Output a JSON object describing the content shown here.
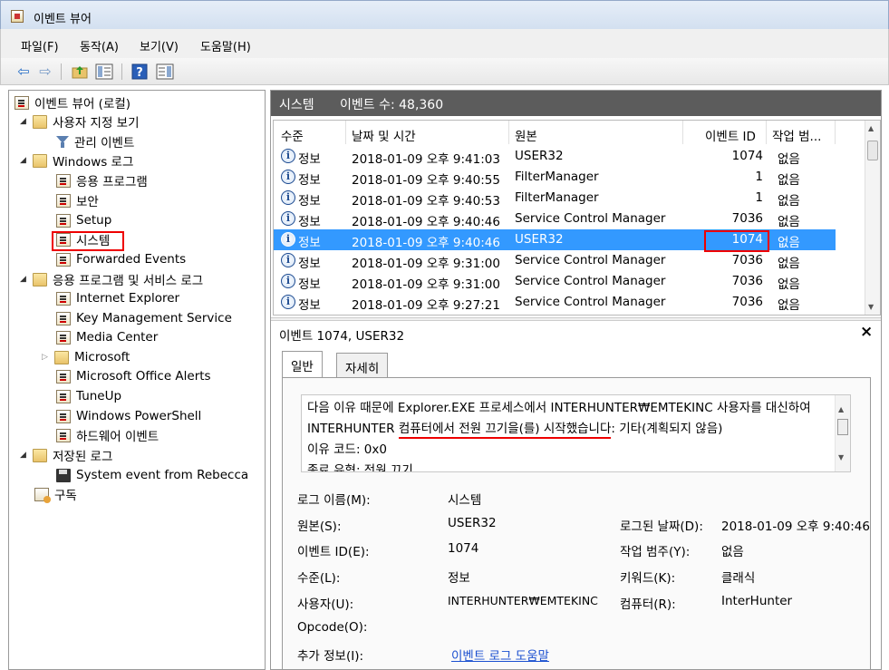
{
  "window": {
    "title": "이벤트 뷰어"
  },
  "menu": [
    "파일(F)",
    "동작(A)",
    "보기(V)",
    "도움말(H)"
  ],
  "toolbar": {
    "back_icon": "back-arrow-icon",
    "forward_icon": "forward-arrow-icon",
    "up_icon": "folder-up-icon",
    "show_tree_icon": "show-hide-tree-icon",
    "help_icon": "help-icon",
    "action_pane_icon": "action-pane-icon"
  },
  "tree": {
    "root": "이벤트 뷰어 (로컬)",
    "custom_views": "사용자 지정 보기",
    "admin_events": "관리 이벤트",
    "windows_logs": "Windows 로그",
    "application": "응용 프로그램",
    "security": "보안",
    "setup": "Setup",
    "system": "시스템",
    "forwarded": "Forwarded Events",
    "apps_services": "응용 프로그램 및 서비스 로그",
    "internet_explorer": "Internet Explorer",
    "key_mgmt": "Key Management Service",
    "media_center": "Media Center",
    "microsoft": "Microsoft",
    "office_alerts": "Microsoft Office Alerts",
    "tuneup": "TuneUp",
    "powershell": "Windows PowerShell",
    "hardware": "하드웨어 이벤트",
    "saved_logs": "저장된 로그",
    "system_from_rebecca": "System event from Rebecca",
    "subscriptions": "구독"
  },
  "log_header": {
    "name": "시스템",
    "count": "이벤트 수: 48,360"
  },
  "list": {
    "columns": {
      "level": "수준",
      "datetime": "날짜 및 시간",
      "source": "원본",
      "event_id": "이벤트 ID",
      "category": "작업 범..."
    },
    "rows": [
      {
        "level": "정보",
        "datetime": "2018-01-09 오후 9:41:03",
        "source": "USER32",
        "event_id": "1074",
        "category": "없음"
      },
      {
        "level": "정보",
        "datetime": "2018-01-09 오후 9:40:55",
        "source": "FilterManager",
        "event_id": "1",
        "category": "없음"
      },
      {
        "level": "정보",
        "datetime": "2018-01-09 오후 9:40:53",
        "source": "FilterManager",
        "event_id": "1",
        "category": "없음"
      },
      {
        "level": "정보",
        "datetime": "2018-01-09 오후 9:40:46",
        "source": "Service Control Manager",
        "event_id": "7036",
        "category": "없음"
      },
      {
        "level": "정보",
        "datetime": "2018-01-09 오후 9:40:46",
        "source": "USER32",
        "event_id": "1074",
        "category": "없음"
      },
      {
        "level": "정보",
        "datetime": "2018-01-09 오후 9:31:00",
        "source": "Service Control Manager",
        "event_id": "7036",
        "category": "없음"
      },
      {
        "level": "정보",
        "datetime": "2018-01-09 오후 9:31:00",
        "source": "Service Control Manager",
        "event_id": "7036",
        "category": "없음"
      },
      {
        "level": "정보",
        "datetime": "2018-01-09 오후 9:27:21",
        "source": "Service Control Manager",
        "event_id": "7036",
        "category": "없음"
      }
    ]
  },
  "details": {
    "title": "이벤트 1074, USER32",
    "tab_general": "일반",
    "tab_details": "자세히",
    "desc_line1": "다음 이유 때문에 Explorer.EXE 프로세스에서 INTERHUNTER₩EMTEKINC 사용자를 대신하여",
    "desc_line2_a": "INTERHUNTER ",
    "desc_line2_b": "컴퓨터에서 전원 끄기을(를) 시작했습니다",
    "desc_line2_c": ": 기타(계획되지 않음)",
    "desc_line3": " 이유 코드: 0x0",
    "desc_line4": " 종료 유형: 전원 끄기",
    "fields": {
      "log_name_label": "로그 이름(M):",
      "log_name": "시스템",
      "source_label": "원본(S):",
      "source": "USER32",
      "logged_label": "로그된 날짜(D):",
      "logged": "2018-01-09 오후 9:40:46",
      "event_id_label": "이벤트 ID(E):",
      "event_id": "1074",
      "task_label": "작업 범주(Y):",
      "task": "없음",
      "level_label": "수준(L):",
      "level": "정보",
      "keywords_label": "키워드(K):",
      "keywords": "클래식",
      "user_label": "사용자(U):",
      "user": "INTERHUNTER₩EMTEKINC",
      "computer_label": "컴퓨터(R):",
      "computer": "InterHunter",
      "opcode_label": "Opcode(O):",
      "more_info_label": "추가 정보(I):",
      "more_info_link": "이벤트 로그 도움말"
    }
  },
  "colors": {
    "accent_select": "#3399ff",
    "header_bar": "#5c5c5c",
    "highlight_red": "#e00000",
    "link": "#1a4fd0"
  }
}
